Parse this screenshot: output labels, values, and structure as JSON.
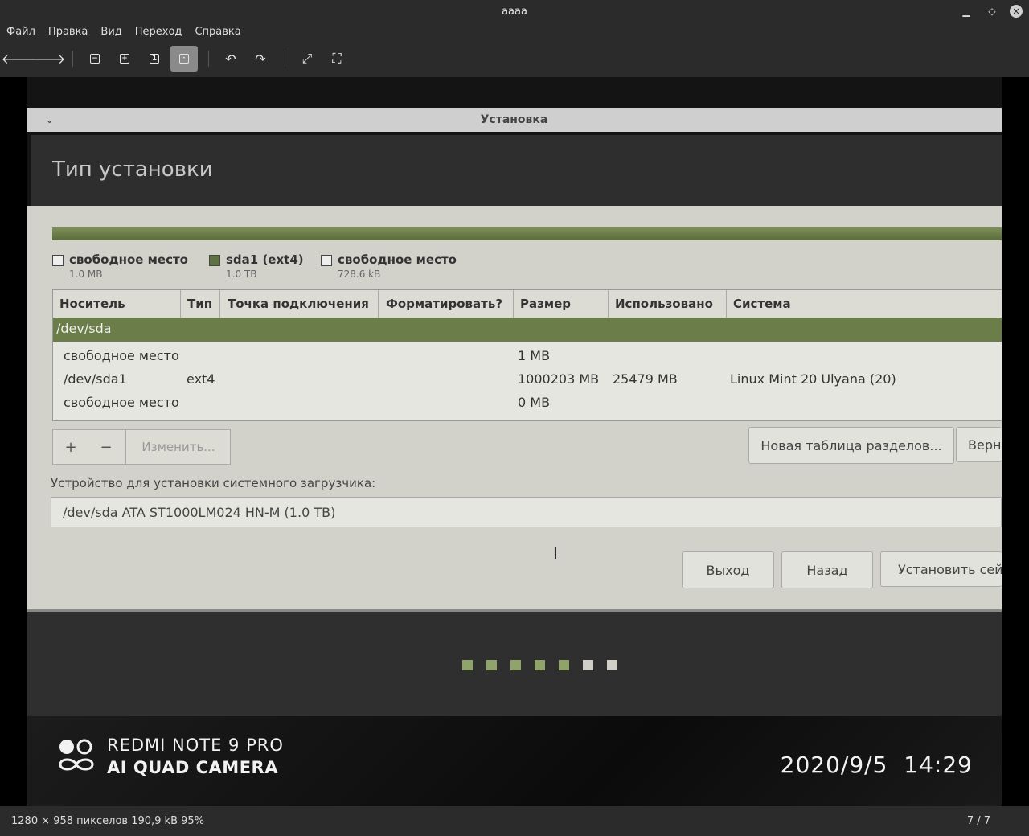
{
  "window": {
    "title": "aaaa"
  },
  "menu": [
    "Файл",
    "Правка",
    "Вид",
    "Переход",
    "Справка"
  ],
  "toolbar": {
    "icons": [
      "back-arrow-icon",
      "forward-arrow-icon",
      "zoom-out-icon",
      "zoom-in-icon",
      "zoom-original-icon",
      "best-fit-icon",
      "rotate-left-icon",
      "rotate-right-icon",
      "fullscreen-icon",
      "slideshow-icon"
    ]
  },
  "photo": {
    "dialog_title": "Установка",
    "page_heading": "Тип установки",
    "legend": [
      {
        "name": "свободное место",
        "size": "1.0 MB"
      },
      {
        "name": "sda1 (ext4)",
        "size": "1.0 TB"
      },
      {
        "name": "свободное место",
        "size": "728.6 kB"
      }
    ],
    "columns": [
      "Носитель",
      "Тип",
      "Точка подключения",
      "Форматировать?",
      "Размер",
      "Использовано",
      "Система"
    ],
    "selected_device": "/dev/sda",
    "rows": [
      {
        "device": "свободное место",
        "type": "",
        "size": "1 MB",
        "used": "",
        "system": ""
      },
      {
        "device": "/dev/sda1",
        "type": "ext4",
        "size": "1000203 MB",
        "used": "25479 MB",
        "system": "Linux Mint 20 Ulyana (20)"
      },
      {
        "device": "свободное место",
        "type": "",
        "size": "0 MB",
        "used": "",
        "system": ""
      }
    ],
    "buttons": {
      "add": "+",
      "remove": "−",
      "change": "Изменить...",
      "new_table": "Новая таблица разделов...",
      "revert": "Верн",
      "quit": "Выход",
      "back": "Назад",
      "install": "Установить сей"
    },
    "bootloader_label": "Устройство для установки системного загрузчика:",
    "bootloader_value": "/dev/sda   ATA ST1000LM024 HN-M (1.0 TB)",
    "progress_dots": {
      "total": 7,
      "done": 5
    },
    "watermark_line1": "REDMI NOTE 9 PRO",
    "watermark_line2": "AI QUAD CAMERA",
    "datetime": "2020/9/5  14:29"
  },
  "status": {
    "info": "1280 × 958 пикселов  190,9 kB   95%",
    "counter": "7 / 7"
  },
  "colors": {
    "chrome": "#2b2b2b",
    "partition_green": "#6b7d48",
    "dialog_bg": "#d2d2cb"
  }
}
